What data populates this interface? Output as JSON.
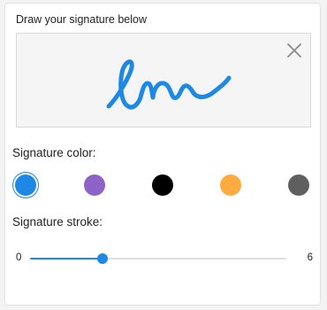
{
  "signature_panel": {
    "heading": "Draw your signature below",
    "clear_icon": "close-icon",
    "signature_stroke_color": "#1e88e5"
  },
  "color_section": {
    "label": "Signature color:",
    "swatches": [
      {
        "name": "blue",
        "color": "#1e88e5",
        "selected": true
      },
      {
        "name": "purple",
        "color": "#8e63c7",
        "selected": false
      },
      {
        "name": "black",
        "color": "#000000",
        "selected": false
      },
      {
        "name": "orange",
        "color": "#ffab40",
        "selected": false
      },
      {
        "name": "gray",
        "color": "#5f5f5f",
        "selected": false
      }
    ]
  },
  "stroke_section": {
    "label": "Signature stroke:",
    "min_label": "0",
    "max_label": "6",
    "min": 0,
    "max": 6,
    "value": 1.7
  },
  "colors": {
    "accent": "#1e88e5",
    "track": "#dedede"
  }
}
